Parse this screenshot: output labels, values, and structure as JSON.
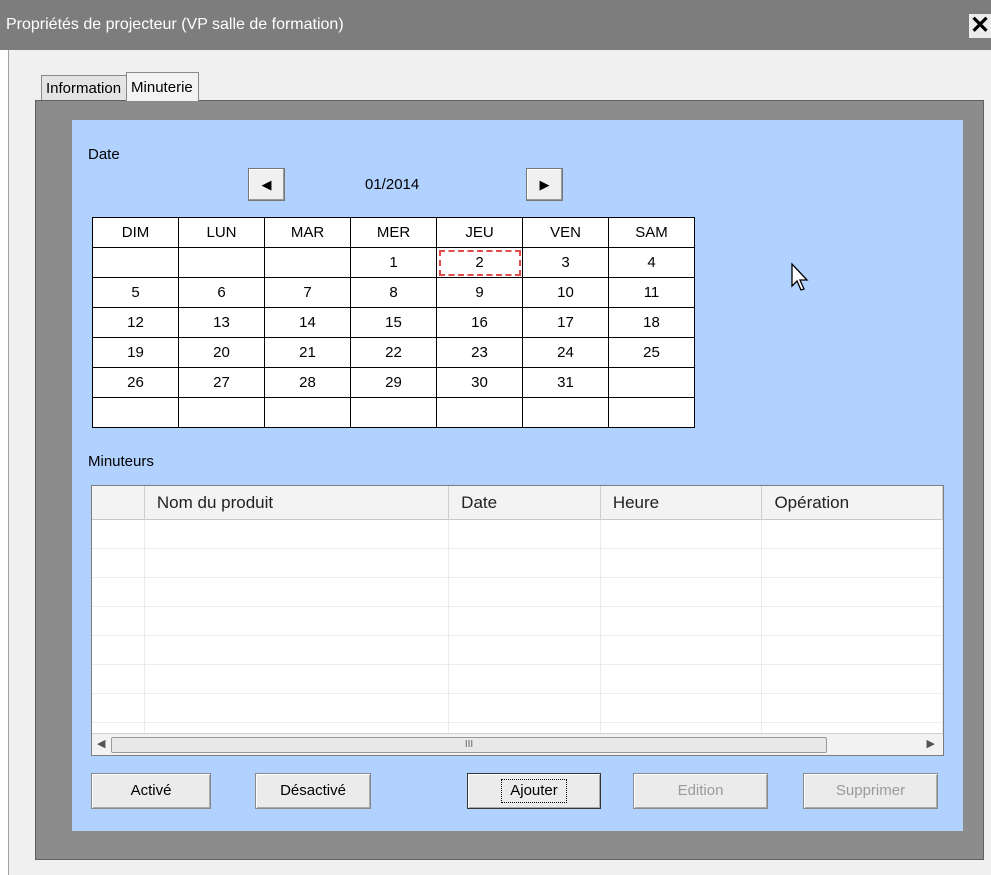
{
  "window": {
    "title": "Propriétés de projecteur (VP salle de formation)",
    "close_icon": "✕"
  },
  "tabs": [
    {
      "label": "Information",
      "active": false
    },
    {
      "label": "Minuterie",
      "active": true
    }
  ],
  "calendar": {
    "section_label": "Date",
    "month_label": "01/2014",
    "prev_icon": "◀",
    "next_icon": "▶",
    "day_headers": [
      "DIM",
      "LUN",
      "MAR",
      "MER",
      "JEU",
      "VEN",
      "SAM"
    ],
    "weeks": [
      [
        "",
        "",
        "",
        "1",
        "2",
        "3",
        "4"
      ],
      [
        "5",
        "6",
        "7",
        "8",
        "9",
        "10",
        "11"
      ],
      [
        "12",
        "13",
        "14",
        "15",
        "16",
        "17",
        "18"
      ],
      [
        "19",
        "20",
        "21",
        "22",
        "23",
        "24",
        "25"
      ],
      [
        "26",
        "27",
        "28",
        "29",
        "30",
        "31",
        ""
      ],
      [
        "",
        "",
        "",
        "",
        "",
        "",
        ""
      ]
    ],
    "focused_day": "2"
  },
  "timers": {
    "section_label": "Minuteurs",
    "columns": [
      "",
      "Nom du produit",
      "Date",
      "Heure",
      "Opération"
    ],
    "rows": [],
    "scroll_left_icon": "◀",
    "scroll_right_icon": "▶",
    "scroll_thumb_grip": "III"
  },
  "buttons": {
    "enable": "Activé",
    "disable": "Désactivé",
    "add": "Ajouter",
    "edit": "Edition",
    "delete": "Supprimer"
  },
  "colors": {
    "panel_bg": "#b1d1ff",
    "title_bg": "#7d7d7d",
    "focus_dash": "#e34b4b"
  }
}
